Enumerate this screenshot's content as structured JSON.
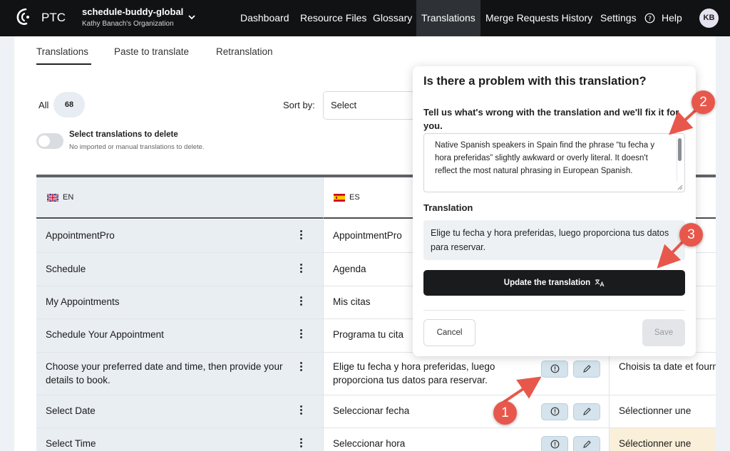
{
  "nav": {
    "brand": "PTC",
    "project_name": "schedule-buddy-global",
    "organization": "Kathy Banach's Organization",
    "links": [
      "Dashboard",
      "Resource Files",
      "Glossary",
      "Translations",
      "Merge Requests History",
      "Settings"
    ],
    "active_link": "Translations",
    "help": "Help",
    "avatar_initials": "KB"
  },
  "tabs": [
    "Translations",
    "Paste to translate",
    "Retranslation"
  ],
  "active_tab": "Translations",
  "filter": {
    "all_label": "All",
    "count": "68",
    "sort_label": "Sort by:",
    "sort_value": "Select"
  },
  "delete_toggle": {
    "title": "Select translations to delete",
    "subtitle": "No imported or manual translations to delete.",
    "on": false
  },
  "table": {
    "columns": [
      "EN",
      "ES"
    ],
    "rows": [
      {
        "en": "AppointmentPro",
        "es": "AppointmentPro",
        "fr": ""
      },
      {
        "en": "Schedule",
        "es": "Agenda",
        "fr": ""
      },
      {
        "en": "My Appointments",
        "es": "Mis citas",
        "fr": ""
      },
      {
        "en": "Schedule Your Appointment",
        "es": "Programa tu cita",
        "fr": ""
      },
      {
        "en": "Choose your preferred date and time, then provide your details to book.",
        "es": "Elige tu fecha y hora preferidas, luego proporciona tus datos para reservar.",
        "fr": "Choisis ta date et fournis tes coord"
      },
      {
        "en": "Select Date",
        "es": "Seleccionar fecha",
        "fr": "Sélectionner une"
      },
      {
        "en": "Select Time",
        "es": "Seleccionar hora",
        "fr": "Sélectionner une"
      }
    ]
  },
  "modal": {
    "title": "Is there a problem with this translation?",
    "feedback_label": "Tell us what's wrong with the translation and we'll fix it for you.",
    "feedback_text": "Native Spanish speakers in Spain find the phrase “tu fecha y hora preferidas” slightly awkward or overly literal. It doesn't reflect the most natural phrasing in European Spanish.",
    "translation_label": "Translation",
    "translation_text": "Elige tu fecha y hora preferidas, luego proporciona tus datos para reservar.",
    "update_button": "Update the translation",
    "cancel_button": "Cancel",
    "save_button": "Save"
  },
  "callouts": [
    "1",
    "2",
    "3"
  ],
  "colors": {
    "nav_bg": "#111214",
    "callout": "#e8574b",
    "row_highlight": "#faefd9",
    "en_column_bg": "#e9eef3",
    "action_button": "#d4e3ec"
  },
  "icons": [
    "logo-icon",
    "chevron-down-icon",
    "help-circle-icon",
    "uk-flag-icon",
    "spain-flag-icon",
    "kebab-menu-icon",
    "report-issue-icon",
    "edit-pencil-icon",
    "translate-icon"
  ]
}
